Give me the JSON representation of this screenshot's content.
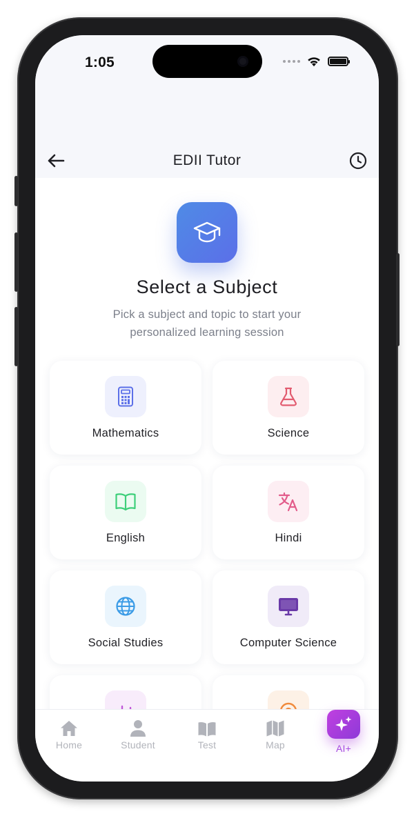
{
  "status_bar": {
    "time": "1:05"
  },
  "header": {
    "title": "EDII Tutor",
    "back_icon": "arrow-left-icon",
    "history_icon": "clock-icon"
  },
  "hero": {
    "icon": "graduation-cap-icon",
    "title": "Select a Subject",
    "subtitle": "Pick a subject and topic to start your personalized learning session"
  },
  "subjects": [
    {
      "label": "Mathematics",
      "icon": "calculator-icon",
      "color": "#5b6fe8",
      "bg": "#eef0fd"
    },
    {
      "label": "Science",
      "icon": "flask-icon",
      "color": "#e25b6f",
      "bg": "#fdeef0"
    },
    {
      "label": "English",
      "icon": "book-icon",
      "color": "#3ecf7a",
      "bg": "#ebfbf1"
    },
    {
      "label": "Hindi",
      "icon": "translate-icon",
      "color": "#e25b8a",
      "bg": "#fdeef3"
    },
    {
      "label": "Social Studies",
      "icon": "globe-icon",
      "color": "#3a9be6",
      "bg": "#eaf5fd"
    },
    {
      "label": "Computer Science",
      "icon": "monitor-icon",
      "color": "#6a3aa8",
      "bg": "#f0ebf8"
    }
  ],
  "bottom_nav": [
    {
      "label": "Home",
      "icon": "home-icon",
      "active": false
    },
    {
      "label": "Student",
      "icon": "user-icon",
      "active": false
    },
    {
      "label": "Test",
      "icon": "book-open-icon",
      "active": false
    },
    {
      "label": "Map",
      "icon": "map-icon",
      "active": false
    },
    {
      "label": "AI+",
      "icon": "sparkles-icon",
      "active": true
    }
  ]
}
